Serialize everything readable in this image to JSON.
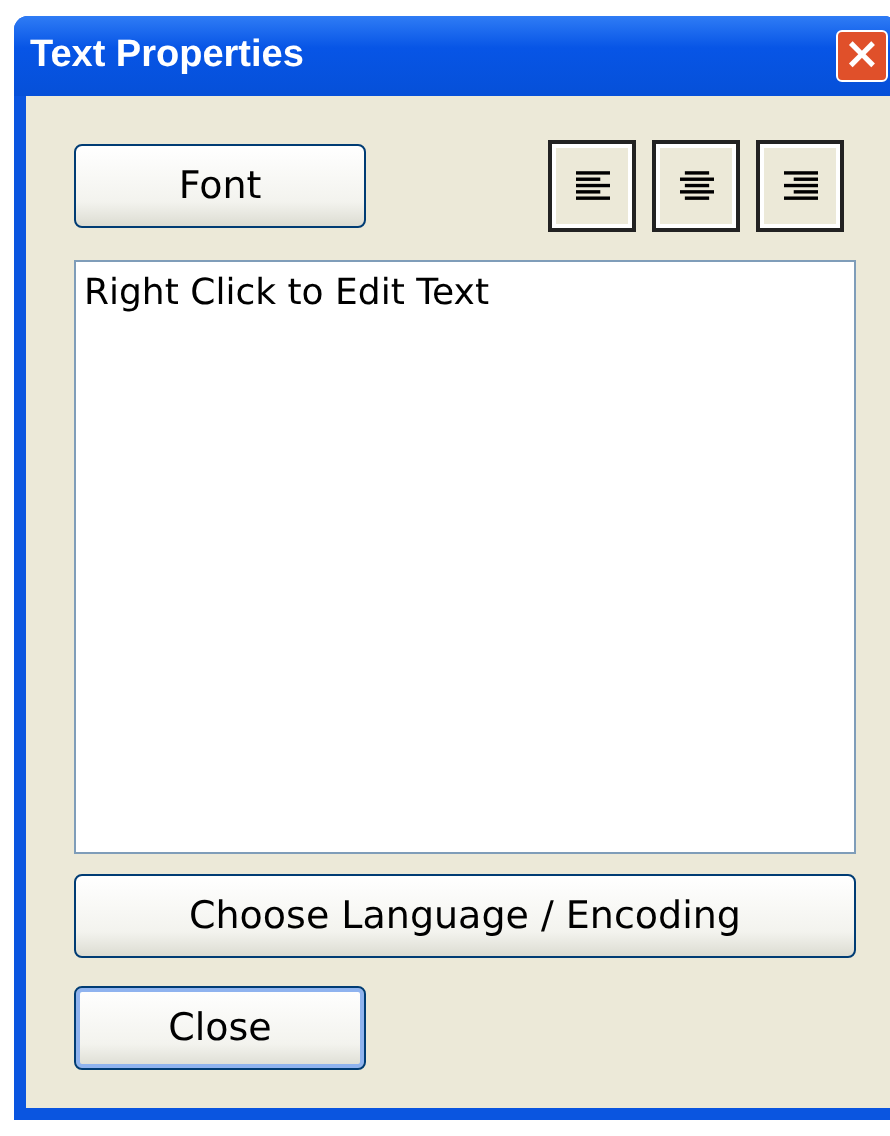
{
  "window": {
    "title": "Text Properties",
    "close_icon": "×"
  },
  "font_button": {
    "label": "Font",
    "default": false
  },
  "align_buttons": [
    {
      "kind": "left",
      "selected": false
    },
    {
      "kind": "center",
      "selected": false
    },
    {
      "kind": "right",
      "selected": false
    }
  ],
  "text_area": {
    "value": "Right Click to Edit Text"
  },
  "language_button": {
    "label": "Choose Language / Encoding",
    "default": false
  },
  "close_button": {
    "label": "Close",
    "default": true
  }
}
